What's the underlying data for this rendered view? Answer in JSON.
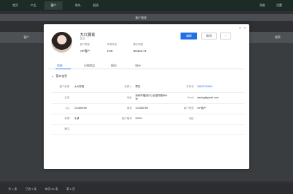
{
  "background": {
    "nav": [
      "首页",
      "产品",
      "客户",
      "联系",
      "报表"
    ],
    "nav_right": [
      "帮助",
      "设置"
    ],
    "subbar_title": "客户管理",
    "row_label": "客户",
    "row_right": "搜索",
    "bottom": [
      "共 1 条",
      "已选 0 条",
      "每页 20 条",
      "第 1 页"
    ]
  },
  "modal": {
    "window_controls": [
      "□",
      "×"
    ],
    "company": "大兴贸易",
    "subname": "章总",
    "stats": [
      {
        "label": "客户类型",
        "value": "VIP客户"
      },
      {
        "label": "审核状态",
        "value": "0.00"
      },
      {
        "label": "累计销售",
        "value": "30,532.74"
      }
    ],
    "buttons": {
      "primary": "编辑",
      "secondary": "取消",
      "more": "···"
    },
    "tabs": [
      "信息",
      "已购商品",
      "报告",
      "统计"
    ],
    "section_title": "基本信息",
    "rows": [
      [
        {
          "label": "客户名称",
          "value": "大兴贸易"
        },
        {
          "label": "负责人",
          "value": "章总"
        },
        {
          "label": "手机号",
          "value": "18529732653"
        }
      ],
      [
        {
          "label": "主体",
          "value": ""
        },
        {
          "label": "地址",
          "value": "深圳市福田中心区福华路888号"
        },
        {
          "label": "Email",
          "value": "daxing@gmail.com"
        }
      ],
      [
        {
          "label": "QQ",
          "value": "123456789"
        },
        {
          "label": "微信",
          "value": "123456789"
        },
        {
          "label": "客户类型",
          "value": "VIP客户"
        }
      ],
      [
        {
          "label": "来源",
          "value": "手调"
        },
        {
          "label": "客户编号",
          "value": "00001"
        },
        {
          "label": "地区",
          "value": ""
        }
      ],
      [
        {
          "label": "备注",
          "value": ""
        }
      ]
    ]
  }
}
